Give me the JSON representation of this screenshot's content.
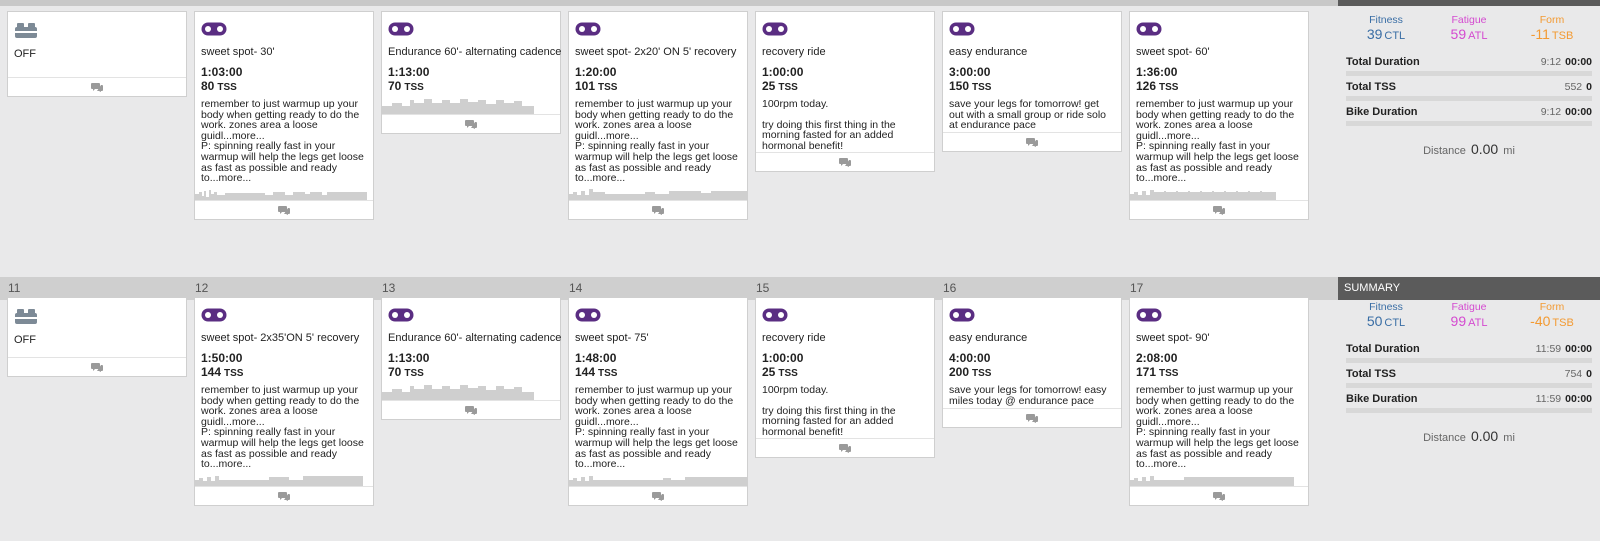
{
  "colors": {
    "accent": "#5a2d82",
    "fitness": "#3a6ea5",
    "fatigue": "#d44ad0",
    "form": "#f39a32",
    "profile": "#cfcfcf"
  },
  "week1": {
    "days": [
      {
        "type": "off",
        "label": "OFF"
      },
      {
        "type": "workout",
        "title": "sweet spot- 30'",
        "duration": "1:03:00",
        "tss": "80",
        "tss_unit": "TSS",
        "desc1": "remember to just warmup up your body when getting ready to do the work. zones area a loose guidl...",
        "more1": "more...",
        "desc2": "P: spinning really fast in your warmup will help the legs get loose as fast as possible and ready to...",
        "more2": "more..."
      },
      {
        "type": "workout",
        "title": "Endurance 60'- alternating cadence",
        "duration": "1:13:00",
        "tss": "70",
        "tss_unit": "TSS"
      },
      {
        "type": "workout",
        "title": "sweet spot- 2x20' ON 5' recovery",
        "duration": "1:20:00",
        "tss": "101",
        "tss_unit": "TSS",
        "desc1": "remember to just warmup up your body when getting ready to do the work. zones area a loose guidl...",
        "more1": "more...",
        "desc2": "P: spinning really fast in your warmup will help the legs get loose as fast as possible and ready to...",
        "more2": "more..."
      },
      {
        "type": "workout",
        "title": "recovery ride",
        "duration": "1:00:00",
        "tss": "25",
        "tss_unit": "TSS",
        "desc1": "100rpm today.",
        "desc2": "try doing this first thing in the morning fasted for an added hormonal benefit!"
      },
      {
        "type": "workout",
        "title": "easy endurance",
        "duration": "3:00:00",
        "tss": "150",
        "tss_unit": "TSS",
        "desc1": "save your legs for tomorrow! get out with a small group or ride solo at endurance pace"
      },
      {
        "type": "workout",
        "title": "sweet spot- 60'",
        "duration": "1:36:00",
        "tss": "126",
        "tss_unit": "TSS",
        "desc1": "remember to just warmup up your body when getting ready to do the work. zones area a loose guidl...",
        "more1": "more...",
        "desc2": "P: spinning really fast in your warmup will help the legs get loose as fast as possible and ready to...",
        "more2": "more..."
      }
    ],
    "summary": {
      "fitness_label": "Fitness",
      "fitness_value": "39",
      "fitness_unit": "CTL",
      "fatigue_label": "Fatigue",
      "fatigue_value": "59",
      "fatigue_unit": "ATL",
      "form_label": "Form",
      "form_value": "-11",
      "form_unit": "TSB",
      "total_duration_label": "Total Duration",
      "total_duration_planned": "9:12",
      "total_duration_actual": "00:00",
      "total_tss_label": "Total TSS",
      "total_tss_planned": "552",
      "total_tss_actual": "0",
      "bike_duration_label": "Bike Duration",
      "bike_duration_planned": "9:12",
      "bike_duration_actual": "00:00",
      "distance_label": "Distance",
      "distance_value": "0.00",
      "distance_unit": "mi"
    }
  },
  "week2": {
    "day_numbers": [
      "11",
      "12",
      "13",
      "14",
      "15",
      "16",
      "17"
    ],
    "summary_header": "SUMMARY",
    "days": [
      {
        "type": "off",
        "label": "OFF"
      },
      {
        "type": "workout",
        "title": "sweet spot- 2x35'ON 5' recovery",
        "duration": "1:50:00",
        "tss": "144",
        "tss_unit": "TSS",
        "desc1": "remember to just warmup up your body when getting ready to do the work. zones area a loose guidl...",
        "more1": "more...",
        "desc2": "P: spinning really fast in your warmup will help the legs get loose as fast as possible and ready to...",
        "more2": "more..."
      },
      {
        "type": "workout",
        "title": "Endurance 60'- alternating cadence",
        "duration": "1:13:00",
        "tss": "70",
        "tss_unit": "TSS"
      },
      {
        "type": "workout",
        "title": "sweet spot- 75'",
        "duration": "1:48:00",
        "tss": "144",
        "tss_unit": "TSS",
        "desc1": "remember to just warmup up your body when getting ready to do the work. zones area a loose guidl...",
        "more1": "more...",
        "desc2": "P: spinning really fast in your warmup will help the legs get loose as fast as possible and ready to...",
        "more2": "more..."
      },
      {
        "type": "workout",
        "title": "recovery ride",
        "duration": "1:00:00",
        "tss": "25",
        "tss_unit": "TSS",
        "desc1": "100rpm today.",
        "desc2": "try doing this first thing in the morning fasted for an added hormonal benefit!"
      },
      {
        "type": "workout",
        "title": "easy endurance",
        "duration": "4:00:00",
        "tss": "200",
        "tss_unit": "TSS",
        "desc1": "save your legs for tomorrow! easy miles today @ endurance pace"
      },
      {
        "type": "workout",
        "title": "sweet spot- 90'",
        "duration": "2:08:00",
        "tss": "171",
        "tss_unit": "TSS",
        "desc1": "remember to just warmup up your body when getting ready to do the work. zones area a loose guidl...",
        "more1": "more...",
        "desc2": "P: spinning really fast in your warmup will help the legs get loose as fast as possible and ready to...",
        "more2": "more..."
      }
    ],
    "summary": {
      "fitness_label": "Fitness",
      "fitness_value": "50",
      "fitness_unit": "CTL",
      "fatigue_label": "Fatigue",
      "fatigue_value": "99",
      "fatigue_unit": "ATL",
      "form_label": "Form",
      "form_value": "-40",
      "form_unit": "TSB",
      "total_duration_label": "Total Duration",
      "total_duration_planned": "11:59",
      "total_duration_actual": "00:00",
      "total_tss_label": "Total TSS",
      "total_tss_planned": "754",
      "total_tss_actual": "0",
      "bike_duration_label": "Bike Duration",
      "bike_duration_planned": "11:59",
      "bike_duration_actual": "00:00",
      "distance_label": "Distance",
      "distance_value": "0.00",
      "distance_unit": "mi"
    }
  }
}
